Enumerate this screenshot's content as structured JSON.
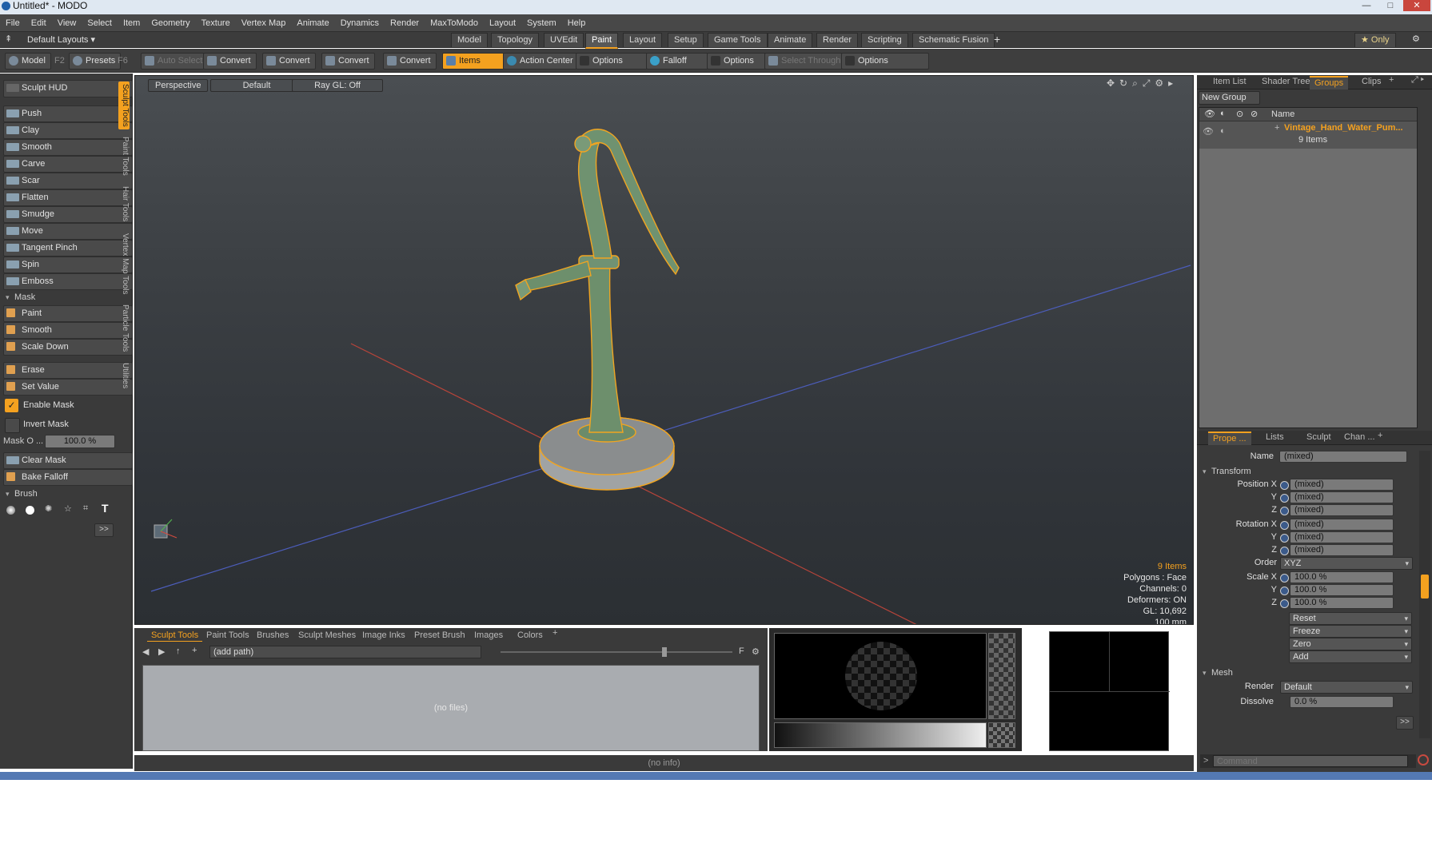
{
  "window": {
    "title": "Untitled* - MODO"
  },
  "menu": [
    "File",
    "Edit",
    "View",
    "Select",
    "Item",
    "Geometry",
    "Texture",
    "Vertex Map",
    "Animate",
    "Dynamics",
    "Render",
    "MaxToModo",
    "Layout",
    "System",
    "Help"
  ],
  "layouts": {
    "current": "Default Layouts ▾",
    "tabs": [
      "Model",
      "Topology",
      "UVEdit",
      "Paint",
      "Layout",
      "Setup",
      "Game Tools",
      "Animate",
      "Render",
      "Scripting",
      "Schematic Fusion"
    ],
    "active": "Paint",
    "only_label": "★ Only"
  },
  "toolbar": {
    "model": "Model",
    "model_key": "F2",
    "presets": "Presets",
    "presets_key": "F6",
    "auto_select": "Auto Select",
    "convert": "Convert",
    "items": "Items",
    "action_center": "Action Center",
    "options": "Options",
    "falloff": "Falloff",
    "select_through": "Select Through"
  },
  "left": {
    "sculpt_hud": "Sculpt HUD",
    "vtabs": [
      "Sculpt Tools",
      "Paint Tools",
      "Hair Tools",
      "Vertex Map Tools",
      "Particle Tools",
      "Utilities"
    ],
    "tools": [
      "Push",
      "Clay",
      "Smooth",
      "Carve",
      "Scar",
      "Flatten",
      "Smudge",
      "Move",
      "Tangent Pinch",
      "Spin",
      "Emboss"
    ],
    "mask_header": "Mask",
    "mask_tools": [
      "Paint",
      "Smooth",
      "Scale Down"
    ],
    "mask_tools2": [
      "Erase",
      "Set Value"
    ],
    "enable_mask": "Enable Mask",
    "invert_mask": "Invert Mask",
    "mask_opacity_label": "Mask O ...",
    "mask_opacity_value": "100.0 %",
    "clear_mask": "Clear Mask",
    "bake_falloff": "Bake Falloff",
    "brush_header": "Brush",
    "expand": ">>"
  },
  "viewport": {
    "perspective": "Perspective",
    "default": "Default",
    "raygl": "Ray GL: Off",
    "info": {
      "items": "9 Items",
      "polygons": "Polygons : Face",
      "channels": "Channels: 0",
      "deformers": "Deformers: ON",
      "gl": "GL: 10,692",
      "scale": "100 mm"
    }
  },
  "right": {
    "tabs": [
      "Item List",
      "Shader Tree",
      "Groups",
      "Clips"
    ],
    "active_tab": "Groups",
    "new_group": "New Group",
    "name_header": "Name",
    "group_name": "Vintage_Hand_Water_Pum...",
    "group_count": "9 Items",
    "prop_tabs": [
      "Prope ...",
      "Lists",
      "Sculpt",
      "Chan ..."
    ],
    "name_label": "Name",
    "name_value": "(mixed)",
    "transform": "Transform",
    "position_x_label": "Position X",
    "rotation_x_label": "Rotation X",
    "scale_x_label": "Scale X",
    "y_label": "Y",
    "z_label": "Z",
    "mixed": "(mixed)",
    "order_label": "Order",
    "order_value": "XYZ",
    "scale_value": "100.0 %",
    "actions": [
      "Reset",
      "Freeze",
      "Zero",
      "Add"
    ],
    "mesh": "Mesh",
    "render_label": "Render",
    "render_value": "Default",
    "dissolve_label": "Dissolve",
    "dissolve_value": "0.0 %",
    "expand": ">>",
    "command_placeholder": "Command"
  },
  "bottom": {
    "tabs": [
      "Sculpt Tools",
      "Paint Tools",
      "Brushes",
      "Sculpt Meshes",
      "Image Inks",
      "Preset Brush",
      "Images",
      "Colors"
    ],
    "active_tab": "Sculpt Tools",
    "path": "(add path)",
    "no_files": "(no files)",
    "status": "(no info)"
  }
}
